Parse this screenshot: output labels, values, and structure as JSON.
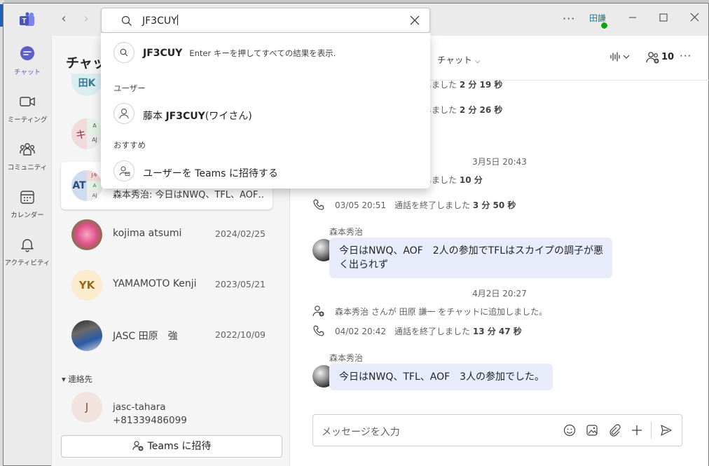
{
  "titlebar": {
    "back_label": "‹",
    "forward_label": "›",
    "more_label": "···",
    "user_initials": "田謙"
  },
  "search": {
    "value": "JF3CUY",
    "suggestion_query": "JF3CUY",
    "suggestion_hint": "Enter キーを押してすべての結果を表示.",
    "section_users": "ユーザー",
    "user_result_prefix": "藤本 ",
    "user_result_bold": "JF3CUY",
    "user_result_suffix": "(ワイさん)",
    "section_recommend": "おすすめ",
    "invite_label": "ユーザーを Teams に招待する"
  },
  "rail": {
    "items": [
      {
        "label": "チャット",
        "icon": "chat-icon"
      },
      {
        "label": "ミーティング",
        "icon": "video-icon"
      },
      {
        "label": "コミュニティ",
        "icon": "community-icon"
      },
      {
        "label": "カレンダー",
        "icon": "calendar-icon"
      },
      {
        "label": "アクティビティ",
        "icon": "bell-icon"
      }
    ]
  },
  "chat_list": {
    "title": "チャット",
    "partial_avatar": "田K",
    "group1_text": "キ",
    "group1_a": "A",
    "group1_aj": "AJ",
    "selected_initials": "AT",
    "selected_j": "Jキ",
    "selected_a": "A",
    "selected_aj": "AJ",
    "selected_preview": "森本秀治: 今日はNWQ、TFL、AOF…",
    "rows": [
      {
        "name": "kojima atsumi",
        "date": "2024/02/25"
      },
      {
        "name": "YAMAMOTO Kenji",
        "date": "2023/05/21",
        "initials": "YK"
      },
      {
        "name": "JASC 田原　強",
        "date": "2022/10/09"
      }
    ],
    "contacts_label": "▾ 連絡先",
    "contact": {
      "initial": "J",
      "name": "jasc-tahara",
      "phone": "+81339486099"
    },
    "invite_button": "Teams に招待"
  },
  "chat": {
    "header_tab": "チャット",
    "participants_count": "10",
    "header_more": "···",
    "sys1": {
      "text": "しました",
      "dur": "2 分 19 秒"
    },
    "sys2": {
      "text": "しました",
      "dur": "2 分 26 秒"
    },
    "date1": "3月5日 20:43",
    "sys3": {
      "text": "しました",
      "dur": "10 分"
    },
    "call1": {
      "time": "03/05 20:51",
      "text": "通話を終了しました",
      "dur": "3 分 50 秒"
    },
    "msg1": {
      "sender": "森本秀治",
      "text": "今日はNWQ、AOF　2人の参加でTFLはスカイプの調子が悪く出られず"
    },
    "date2": "4月2日 20:27",
    "added": "森本秀治 さんが 田原 謙一 をチャットに追加しました。",
    "call2": {
      "time": "04/02 20:42",
      "text": "通話を終了しました",
      "dur": "13 分 47 秒"
    },
    "msg2": {
      "sender": "森本秀治",
      "text": "今日はNWQ、TFL、AOF　3人の参加でした。"
    },
    "composer_placeholder": "メッセージを入力"
  },
  "colors": {
    "brand": "#5b5fc7",
    "bubble": "#e8ebfa",
    "presence": "#13a10e"
  }
}
